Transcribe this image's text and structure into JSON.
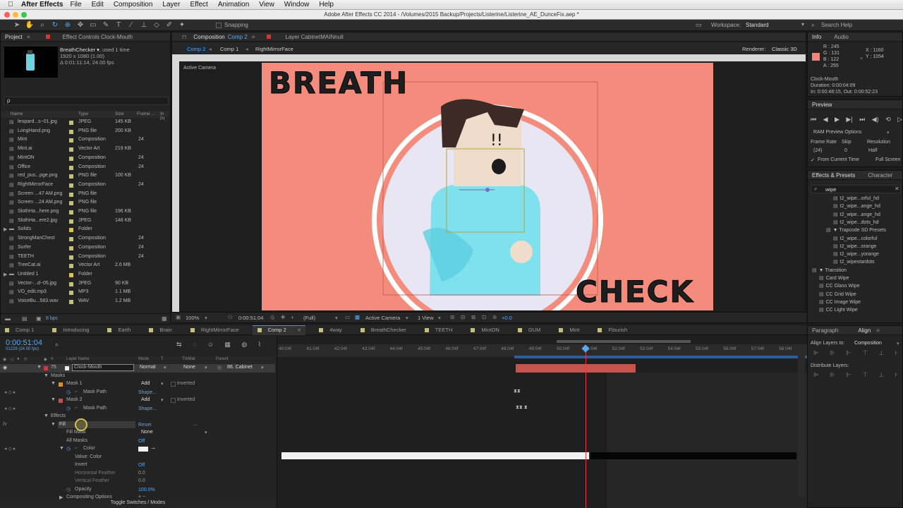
{
  "menubar": {
    "app": "After Effects",
    "items": [
      "File",
      "Edit",
      "Composition",
      "Layer",
      "Effect",
      "Animation",
      "View",
      "Window",
      "Help"
    ]
  },
  "window_title": "Adobe After Effects CC 2014 - /Volumes/2015 Backup/Projects/Listerine/Listerine_AE_DunceFix.aep *",
  "toolbar": {
    "snapping": "Snapping",
    "workspace_label": "Workspace:",
    "workspace_value": "Standard",
    "search_help": "Search Help"
  },
  "project_panel": {
    "tab_project": "Project",
    "tab_effect_controls": "Effect Controls Clock-Mouth",
    "item_name": "BreathChecker ▾",
    "item_used": ", used 1 time",
    "item_dims": "1920 x 1080 (1.00)",
    "item_duration": "Δ 0:01:11:14, 24.00 fps",
    "search_placeholder": "ρ",
    "columns": [
      "Name",
      "Type",
      "Size",
      "Frame ...",
      "In Pt"
    ],
    "bpc": "8 bpc",
    "rows": [
      {
        "name": "leopard...s~01.jpg",
        "type": "JPEG",
        "size": "145 KB",
        "frame": "",
        "color": "#c7c07a"
      },
      {
        "name": "LongHand.png",
        "type": "PNG file",
        "size": "200 KB",
        "frame": "",
        "color": "#c7c07a"
      },
      {
        "name": "Mint",
        "type": "Composition",
        "size": "",
        "frame": "24",
        "color": "#c7c07a"
      },
      {
        "name": "Mint.ai",
        "type": "Vector Art",
        "size": "219 KB",
        "frame": "",
        "color": "#c7c07a"
      },
      {
        "name": "MintON",
        "type": "Composition",
        "size": "",
        "frame": "24",
        "color": "#c7c07a"
      },
      {
        "name": "Office",
        "type": "Composition",
        "size": "",
        "frame": "24",
        "color": "#c7c07a"
      },
      {
        "name": "red_pus...pge.png",
        "type": "PNG file",
        "size": "100 KB",
        "frame": "",
        "color": "#c7c07a"
      },
      {
        "name": "RightMirrorFace",
        "type": "Composition",
        "size": "",
        "frame": "24",
        "color": "#c7c07a"
      },
      {
        "name": "Screen ...47 AM.png",
        "type": "PNG file",
        "size": "",
        "frame": "",
        "color": "#c7c07a"
      },
      {
        "name": "Screen ...24 AM.png",
        "type": "PNG file",
        "size": "",
        "frame": "",
        "color": "#c7c07a"
      },
      {
        "name": "SlothHa...here.png",
        "type": "PNG file",
        "size": "196 KB",
        "frame": "",
        "color": "#c7c07a"
      },
      {
        "name": "SlothHa...ere2.jpg",
        "type": "JPEG",
        "size": "146 KB",
        "frame": "",
        "color": "#c7c07a"
      },
      {
        "name": "Solids",
        "type": "Folder",
        "size": "",
        "frame": "",
        "color": "#d9c44a"
      },
      {
        "name": "StrongManChest",
        "type": "Composition",
        "size": "",
        "frame": "24",
        "color": "#c7c07a"
      },
      {
        "name": "Surfer",
        "type": "Composition",
        "size": "",
        "frame": "24",
        "color": "#c7c07a"
      },
      {
        "name": "TEETH",
        "type": "Composition",
        "size": "",
        "frame": "24",
        "color": "#c7c07a"
      },
      {
        "name": "TreeCat.ai",
        "type": "Vector Art",
        "size": "2.6 MB",
        "frame": "",
        "color": "#c7c07a"
      },
      {
        "name": "Untitled 1",
        "type": "Folder",
        "size": "",
        "frame": "",
        "color": "#d9c44a"
      },
      {
        "name": "Vector-...d~05.jpg",
        "type": "JPEG",
        "size": "90 KB",
        "frame": "",
        "color": "#c7c07a"
      },
      {
        "name": "VO_edit.mp3",
        "type": "MP3",
        "size": "1.1 MB",
        "frame": "",
        "color": "#c7c07a"
      },
      {
        "name": "VoiceBu...583.wav",
        "type": "WAV",
        "size": "1.2 MB",
        "frame": "",
        "color": "#c7c07a"
      }
    ]
  },
  "composition_panel": {
    "tab_composition": "Composition",
    "tab_comp_name": "Comp 2",
    "tab_layer": "Layer CabinetMAINnull",
    "breadcrumbs": [
      "Comp 2",
      "Comp 1",
      "RightMirrorFace"
    ],
    "renderer_label": "Renderer:",
    "renderer_value": "Classic 3D",
    "active_camera_label": "Active Camera",
    "canvas_text_top": "BREATH",
    "canvas_text_bottom": "CHECK",
    "exclaim": "!!",
    "footer": {
      "zoom": "100%",
      "timecode": "0:00:51:04",
      "resolution": "(Full)",
      "camera": "Active Camera",
      "view": "1 View",
      "exposure": "+0.0"
    }
  },
  "info_panel": {
    "tab_info": "Info",
    "tab_audio": "Audio",
    "r": "R : 245",
    "g": "G : 131",
    "b": "B : 122",
    "a": "A : 255",
    "x": "X : 1160",
    "y": "Y : 1054",
    "layer_name": "Clock-Mouth",
    "duration": "Duration: 0:00:04:09",
    "inout": "In: 0:00:48:15, Out: 0:00:52:23"
  },
  "preview_panel": {
    "title": "Preview",
    "ram_options": "RAM Preview Options",
    "frame_rate_label": "Frame Rate",
    "skip_label": "Skip",
    "resolution_label": "Resolution",
    "frame_rate_value": "(24)",
    "skip_value": "0",
    "resolution_value": "Half",
    "from_current": "From Current Time",
    "full_screen": "Full Screen"
  },
  "effects_panel": {
    "tab_effects": "Effects & Presets",
    "tab_character": "Character",
    "search_value": "wipe",
    "items": [
      {
        "label": "t2_wipe...orful_hd",
        "indent": 3
      },
      {
        "label": "t2_wipe...ange_hd",
        "indent": 3
      },
      {
        "label": "t2_wipe...ange_hd",
        "indent": 3
      },
      {
        "label": "t2_wipe...dots_hd",
        "indent": 3
      },
      {
        "label": "▼ Trapcode SD Presets",
        "indent": 2
      },
      {
        "label": "t2_wipe...colorful",
        "indent": 3
      },
      {
        "label": "t2_wipe...orange",
        "indent": 3
      },
      {
        "label": "t2_wipe...yorange",
        "indent": 3
      },
      {
        "label": "t2_wipestardots",
        "indent": 3
      },
      {
        "label": "▼ Transition",
        "indent": 0
      },
      {
        "label": "Card Wipe",
        "indent": 1
      },
      {
        "label": "CC Glass Wipe",
        "indent": 1
      },
      {
        "label": "CC Grid Wipe",
        "indent": 1
      },
      {
        "label": "CC Image Wipe",
        "indent": 1
      },
      {
        "label": "CC Light Wipe",
        "indent": 1
      }
    ]
  },
  "align_panel": {
    "tab_paragraph": "Paragraph",
    "tab_align": "Align",
    "align_to_label": "Align Layers to:",
    "align_to_value": "Composition",
    "distribute_label": "Distribute Layers:"
  },
  "timeline_tabs": [
    {
      "label": "Comp 1",
      "color": "#c7c07a",
      "selected": false
    },
    {
      "label": "Introducing",
      "color": "#c7c07a",
      "selected": false
    },
    {
      "label": "Earth",
      "color": "#c7c07a",
      "selected": false
    },
    {
      "label": "Brain",
      "color": "#c7c07a",
      "selected": false
    },
    {
      "label": "RightMirrorFace",
      "color": "#c7c07a",
      "selected": false
    },
    {
      "label": "Comp 2",
      "color": "#c7c07a",
      "selected": true
    },
    {
      "label": "4way",
      "color": "#c7c07a",
      "selected": false
    },
    {
      "label": "BreathChecker",
      "color": "#c7c07a",
      "selected": false
    },
    {
      "label": "TEETH",
      "color": "#c7c07a",
      "selected": false
    },
    {
      "label": "MintON",
      "color": "#c7c07a",
      "selected": false
    },
    {
      "label": "GUM",
      "color": "#c7c07a",
      "selected": false
    },
    {
      "label": "Mint",
      "color": "#c7c07a",
      "selected": false
    },
    {
      "label": "Flourish",
      "color": "#c7c07a",
      "selected": false
    }
  ],
  "timeline": {
    "timecode": "0:00:51:04",
    "frame_info": "01228 (24.00 fps)",
    "col_layer_name": "Layer Name",
    "col_mode": "Mode",
    "col_trkmat": "TrkMat",
    "col_parent": "Parent",
    "layer_number": "75",
    "layer_name": "Clock-Mouth",
    "layer_mode": "Normal",
    "layer_trkmat": "None",
    "layer_parent": "86. Cabinet",
    "ruler_ticks": [
      "40:04f",
      "41:04f",
      "42:04f",
      "43:04f",
      "44:04f",
      "45:04f",
      "46:04f",
      "47:04f",
      "48:04f",
      "49:04f",
      "50:04f",
      "51:04f",
      "52:04f",
      "53:04f",
      "54:04f",
      "55:04f",
      "56:04f",
      "57:04f",
      "58:04f"
    ],
    "props": {
      "masks": "Masks",
      "mask1": "Mask 1",
      "mask1_mode": "Add",
      "mask1_inverted": "Inverted",
      "mask_path": "Mask Path",
      "shape": "Shape...",
      "mask2": "Mask 2",
      "mask2_mode": "Add",
      "mask2_inverted": "Inverted",
      "effects": "Effects",
      "fill": "Fill",
      "reset": "Reset",
      "fill_mask": "Fill Mask",
      "fill_mask_value": "None",
      "all_masks": "All Masks",
      "all_masks_value": "Off",
      "color": "Color",
      "value_color": "Value: Color",
      "invert": "Invert",
      "invert_value": "Off",
      "h_feather": "Horizontal Feather",
      "h_feather_value": "0.0",
      "v_feather": "Vertical Feather",
      "v_feather_value": "0.0",
      "opacity": "Opacity",
      "opacity_value": "100.0%",
      "compositing": "Compositing Options",
      "toggle": "Toggle Switches / Modes"
    }
  }
}
